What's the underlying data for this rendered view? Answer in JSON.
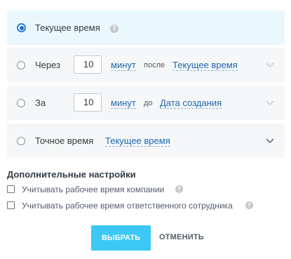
{
  "options": [
    {
      "label": "Текущее время",
      "selected": true
    },
    {
      "label": "Через",
      "number": "10",
      "unit": "минут",
      "relation": "после",
      "base": "Текущее время",
      "selected": false
    },
    {
      "label": "За",
      "number": "10",
      "unit": "минут",
      "relation": "до",
      "base": "Дата создания",
      "selected": false
    },
    {
      "label": "Точное время",
      "base": "Текущее время",
      "selected": false
    }
  ],
  "help_glyph": "?",
  "additional": {
    "title": "Дополнительные настройки",
    "checkboxes": [
      {
        "label": "Учитывать рабочее время компании",
        "checked": false
      },
      {
        "label": "Учитывать рабочее время ответственного сотрудника",
        "checked": false
      }
    ]
  },
  "actions": {
    "select_label": "ВЫБРАТЬ",
    "cancel_label": "ОТМЕНИТЬ"
  },
  "colors": {
    "accent": "#3bc8f5",
    "link": "#2067b0",
    "selected_bg": "#eaf8fe",
    "option_bg": "#f5f7f8"
  },
  "icons": {
    "help": "question-circle-icon",
    "expand": "chevron-down-icon"
  }
}
